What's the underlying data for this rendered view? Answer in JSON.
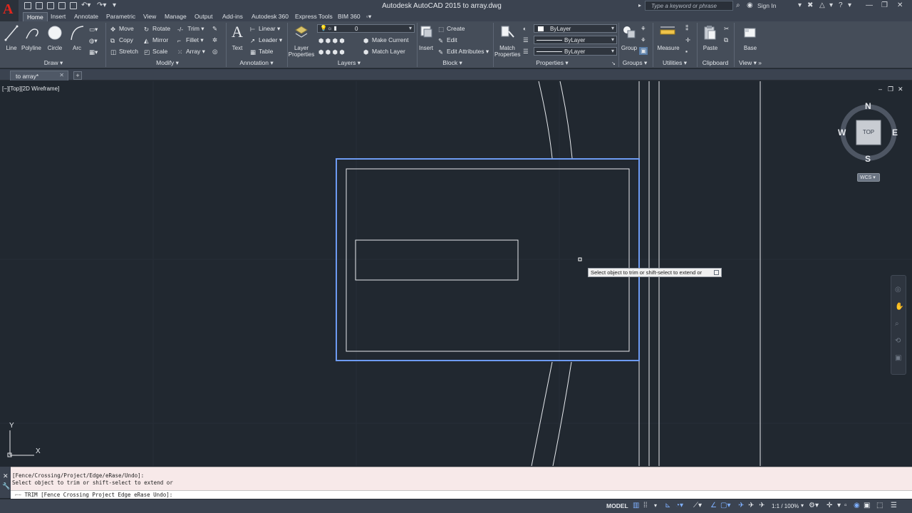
{
  "app": {
    "title": "Autodesk AutoCAD 2015    to array.dwg",
    "search_placeholder": "Type a keyword or phrase",
    "sign_in": "Sign In"
  },
  "menu_tabs": [
    {
      "label": "Home",
      "active": true
    },
    {
      "label": "Insert"
    },
    {
      "label": "Annotate"
    },
    {
      "label": "Parametric"
    },
    {
      "label": "View"
    },
    {
      "label": "Manage"
    },
    {
      "label": "Output"
    },
    {
      "label": "Add-ins"
    },
    {
      "label": "Autodesk 360"
    },
    {
      "label": "Express Tools"
    },
    {
      "label": "BIM 360"
    }
  ],
  "ribbon": {
    "draw": {
      "label": "Draw",
      "line": "Line",
      "polyline": "Polyline",
      "circle": "Circle",
      "arc": "Arc"
    },
    "modify": {
      "label": "Modify",
      "move": "Move",
      "rotate": "Rotate",
      "trim": "Trim",
      "copy": "Copy",
      "mirror": "Mirror",
      "fillet": "Fillet",
      "stretch": "Stretch",
      "scale": "Scale",
      "array": "Array"
    },
    "annotation": {
      "label": "Annotation",
      "text": "Text",
      "linear": "Linear",
      "leader": "Leader",
      "table": "Table"
    },
    "layers": {
      "label": "Layers",
      "layer_properties": "Layer Properties",
      "layer_value": "0",
      "make_current": "Make Current",
      "match_layer": "Match Layer"
    },
    "block": {
      "label": "Block",
      "insert": "Insert",
      "create": "Create",
      "edit": "Edit",
      "edit_attributes": "Edit Attributes"
    },
    "properties": {
      "label": "Properties",
      "match_properties": "Match Properties",
      "color": "ByLayer",
      "linetype": "ByLayer",
      "lineweight": "ByLayer"
    },
    "groups": {
      "label": "Groups",
      "group": "Group"
    },
    "utilities": {
      "label": "Utilities",
      "measure": "Measure"
    },
    "clipboard": {
      "label": "Clipboard",
      "paste": "Paste"
    },
    "view": {
      "label": "View",
      "base": "Base"
    }
  },
  "file_tab": {
    "label": "to array*"
  },
  "viewport": {
    "label": "[−][Top][2D Wireframe]",
    "compass": {
      "n": "N",
      "s": "S",
      "e": "E",
      "w": "W",
      "cube_face": "TOP"
    },
    "wcs": "WCS",
    "ucs_x": "X",
    "ucs_y": "Y",
    "tooltip": "Select object to trim or shift-select to extend or"
  },
  "command": {
    "history_line1": "[Fence/Crossing/Project/Edge/eRase/Undo]:",
    "history_line2": "Select object to trim or shift-select to extend or",
    "prompt": "TRIM [Fence Crossing Project Edge eRase Undo]:"
  },
  "status": {
    "model": "MODEL",
    "scale": "1:1 / 100%"
  }
}
